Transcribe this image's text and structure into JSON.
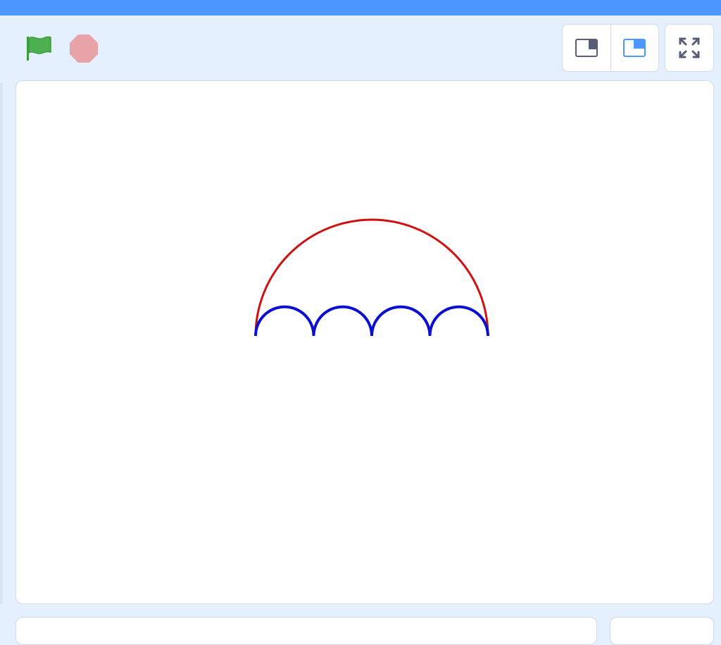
{
  "toolbar": {
    "green_flag_icon": "green-flag-icon",
    "stop_icon": "stop-icon",
    "small_stage_icon": "small-stage-icon",
    "large_stage_icon": "large-stage-icon",
    "fullscreen_icon": "fullscreen-icon",
    "active_layout": "large-stage"
  },
  "stage": {
    "drawing": {
      "big_arc_color": "#d01010",
      "small_arcs_color": "#0a10d0",
      "small_arc_count": 4
    }
  },
  "colors": {
    "accent": "#4c97ff",
    "background": "#e5f0ff",
    "flag_green": "#4caf50",
    "stop_red": "#e7a3a8"
  }
}
